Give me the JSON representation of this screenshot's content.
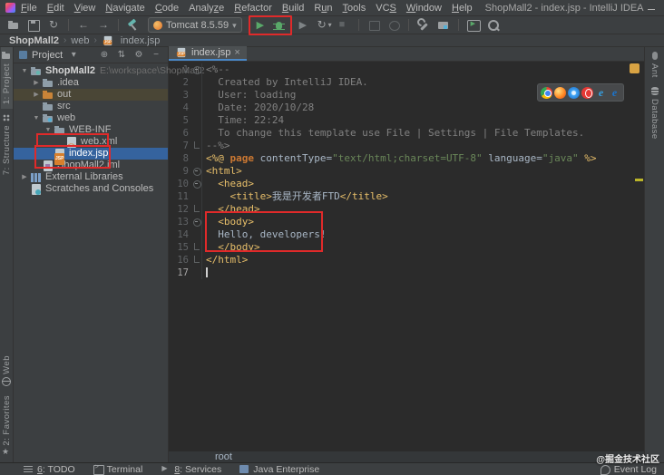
{
  "window": {
    "title": "ShopMall2 - index.jsp - IntelliJ IDEA"
  },
  "menu": {
    "items": [
      {
        "label": "File",
        "mnemonic": "F"
      },
      {
        "label": "Edit",
        "mnemonic": "E"
      },
      {
        "label": "View",
        "mnemonic": "V"
      },
      {
        "label": "Navigate",
        "mnemonic": "N"
      },
      {
        "label": "Code",
        "mnemonic": "C"
      },
      {
        "label": "Analyze",
        "mnemonic": "z"
      },
      {
        "label": "Refactor",
        "mnemonic": "R"
      },
      {
        "label": "Build",
        "mnemonic": "B"
      },
      {
        "label": "Run",
        "mnemonic": "u"
      },
      {
        "label": "Tools",
        "mnemonic": "T"
      },
      {
        "label": "VCS",
        "mnemonic": "S"
      },
      {
        "label": "Window",
        "mnemonic": "W"
      },
      {
        "label": "Help",
        "mnemonic": "H"
      }
    ]
  },
  "toolbar": {
    "run_config": "Tomcat 8.5.59"
  },
  "nav_breadcrumb": {
    "items": [
      {
        "label": "ShopMall2"
      },
      {
        "label": "web"
      },
      {
        "label": "index.jsp",
        "icon": "jsp-file-icon"
      }
    ]
  },
  "left_stripe": {
    "top": [
      {
        "label": "1: Project",
        "icon": "project-tool-icon",
        "active": true
      },
      {
        "label": "7: Structure",
        "icon": "structure-tool-icon"
      }
    ],
    "bottom": [
      {
        "label": "Web",
        "icon": "web-tool-icon"
      },
      {
        "label": "2: Favorites",
        "icon": "favorites-star-icon"
      }
    ]
  },
  "right_stripe": {
    "top": [
      {
        "label": "Ant",
        "icon": "ant-tool-icon"
      },
      {
        "label": "Database",
        "icon": "database-tool-icon"
      }
    ]
  },
  "project_panel": {
    "title": "Project",
    "tree": [
      {
        "label": "ShopMall2",
        "suffix": "E:\\workspace\\ShopMall2",
        "depth": 0,
        "icon": "project-folder-icon",
        "chevron": "expanded",
        "bold": true
      },
      {
        "label": ".idea",
        "depth": 1,
        "icon": "folder-icon",
        "chevron": "collapsed"
      },
      {
        "label": "out",
        "depth": 1,
        "icon": "excluded-folder-icon",
        "chevron": "collapsed",
        "highlight": true
      },
      {
        "label": "src",
        "depth": 1,
        "icon": "folder-icon",
        "chevron": "none"
      },
      {
        "label": "web",
        "depth": 1,
        "icon": "web-folder-icon",
        "chevron": "expanded"
      },
      {
        "label": "WEB-INF",
        "depth": 2,
        "icon": "folder-icon",
        "chevron": "expanded"
      },
      {
        "label": "web.xml",
        "depth": 3,
        "icon": "xml-file-icon",
        "chevron": "none"
      },
      {
        "label": "index.jsp",
        "depth": 2,
        "icon": "jsp-file-icon",
        "chevron": "none",
        "selected": true
      },
      {
        "label": "ShopMall2.iml",
        "depth": 1,
        "icon": "iml-file-icon",
        "chevron": "none"
      },
      {
        "label": "External Libraries",
        "depth": 0,
        "icon": "libraries-icon",
        "chevron": "collapsed"
      },
      {
        "label": "Scratches and Consoles",
        "depth": 0,
        "icon": "scratches-icon",
        "chevron": "none"
      }
    ]
  },
  "editor": {
    "tab": "index.jsp",
    "breadcrumb": "root",
    "browser_icons": [
      "chrome",
      "firefox",
      "safari",
      "opera",
      "ie",
      "edge"
    ],
    "code_lines": [
      {
        "n": 1,
        "fold": "start",
        "segments": [
          {
            "t": "<%--",
            "c": "cm"
          }
        ]
      },
      {
        "n": 2,
        "segments": [
          {
            "t": "  Created by IntelliJ IDEA.",
            "c": "cm"
          }
        ]
      },
      {
        "n": 3,
        "segments": [
          {
            "t": "  User: loading",
            "c": "cm"
          }
        ]
      },
      {
        "n": 4,
        "segments": [
          {
            "t": "  Date: 2020/10/28",
            "c": "cm"
          }
        ]
      },
      {
        "n": 5,
        "segments": [
          {
            "t": "  Time: 22:24",
            "c": "cm"
          }
        ]
      },
      {
        "n": 6,
        "segments": [
          {
            "t": "  To change this template use File | Settings | File Templates.",
            "c": "cm"
          }
        ]
      },
      {
        "n": 7,
        "fold": "end",
        "segments": [
          {
            "t": "--%>",
            "c": "cm"
          }
        ]
      },
      {
        "n": 8,
        "segments": [
          {
            "t": "<%@ ",
            "c": "tag"
          },
          {
            "t": "page ",
            "c": "kw"
          },
          {
            "t": "contentType=",
            "c": "txt"
          },
          {
            "t": "\"text/html;charset=UTF-8\"",
            "c": "str"
          },
          {
            "t": " language=",
            "c": "txt"
          },
          {
            "t": "\"java\"",
            "c": "str"
          },
          {
            "t": " %>",
            "c": "tag"
          }
        ]
      },
      {
        "n": 9,
        "fold": "start",
        "segments": [
          {
            "t": "<html>",
            "c": "tag"
          }
        ]
      },
      {
        "n": 10,
        "fold": "start",
        "segments": [
          {
            "t": "  <head>",
            "c": "tag"
          }
        ]
      },
      {
        "n": 11,
        "segments": [
          {
            "t": "    ",
            "c": "txt"
          },
          {
            "t": "<title>",
            "c": "tag"
          },
          {
            "t": "我是开发者FTD",
            "c": "txt"
          },
          {
            "t": "</title>",
            "c": "tag"
          }
        ]
      },
      {
        "n": 12,
        "fold": "end",
        "segments": [
          {
            "t": "  </head>",
            "c": "tag"
          }
        ]
      },
      {
        "n": 13,
        "fold": "start",
        "segments": [
          {
            "t": "  <body>",
            "c": "tag"
          }
        ]
      },
      {
        "n": 14,
        "segments": [
          {
            "t": "  Hello, developers!",
            "c": "txt"
          }
        ]
      },
      {
        "n": 15,
        "fold": "end",
        "segments": [
          {
            "t": "  </body>",
            "c": "tag"
          }
        ]
      },
      {
        "n": 16,
        "fold": "end",
        "segments": [
          {
            "t": "</html>",
            "c": "tag"
          }
        ]
      },
      {
        "n": 17,
        "cursor": true,
        "segments": []
      }
    ]
  },
  "status_bar": {
    "left": [
      {
        "label": "6: TODO",
        "mnemonic": "6",
        "icon": "todo-list-icon"
      },
      {
        "label": "Terminal",
        "icon": "terminal-icon"
      },
      {
        "label": "8: Services",
        "mnemonic": "8",
        "icon": "services-icon"
      },
      {
        "label": "Java Enterprise",
        "icon": "java-enterprise-icon"
      }
    ],
    "right": [
      {
        "label": "Event Log",
        "icon": "event-log-icon"
      }
    ]
  },
  "watermark": "@掘金技术社区",
  "colors": {
    "accent_blue": "#4A88C7",
    "selection_blue": "#35639E",
    "run_green": "#59A869",
    "annotation_red": "#E02A2A",
    "warning_yellow": "#D9A343",
    "editor_bg": "#2B2B2B",
    "chrome_bg": "#3C3F41"
  }
}
